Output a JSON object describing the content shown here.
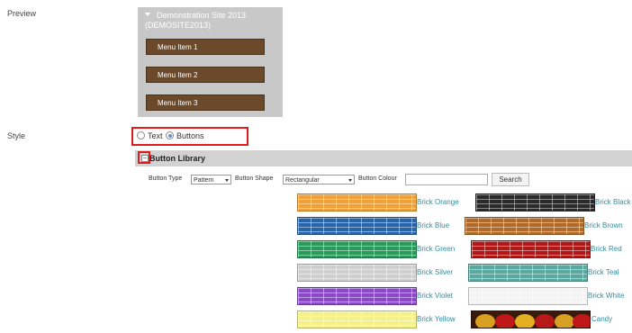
{
  "preview": {
    "label": "Preview",
    "site_title_line1": "Demonstration Site 2013",
    "site_title_line2": "(DEMOSITE2013)",
    "menu_items": [
      "Menu Item 1",
      "Menu Item 2",
      "Menu Item 3"
    ]
  },
  "style": {
    "label": "Style",
    "option_text": "Text",
    "option_buttons": "Buttons",
    "selected": "Buttons"
  },
  "library": {
    "title": "Button Library",
    "button_type_label": "Button Type",
    "button_type_value": "Pattern",
    "button_shape_label": "Button Shape",
    "button_shape_value": "Rectangular",
    "button_colour_label": "Button Colour",
    "button_colour_value": "",
    "search_label": "Search",
    "buttons": [
      {
        "label": "Brick Orange",
        "color": "#f0a035"
      },
      {
        "label": "Brick Black",
        "color": "#2a2a2a"
      },
      {
        "label": "Brick Blue",
        "color": "#2a64a8"
      },
      {
        "label": "Brick Brown",
        "color": "#b06a2a"
      },
      {
        "label": "Brick Green",
        "color": "#2a9a5a"
      },
      {
        "label": "Brick Red",
        "color": "#b01818"
      },
      {
        "label": "Brick Silver",
        "color": "#cfcfcf"
      },
      {
        "label": "Brick Teal",
        "color": "#5aa8a0"
      },
      {
        "label": "Brick Violet",
        "color": "#8a4ac8"
      },
      {
        "label": "Brick White",
        "color": "#f4f4f4"
      },
      {
        "label": "Brick Yellow",
        "color": "#f4f08a"
      },
      {
        "label": "Candy",
        "color": "#c01818"
      }
    ]
  },
  "colors": {
    "highlight_border": "#e01b1b",
    "link": "#2f8da3",
    "menu_item_bg": "#6b4a2b"
  }
}
